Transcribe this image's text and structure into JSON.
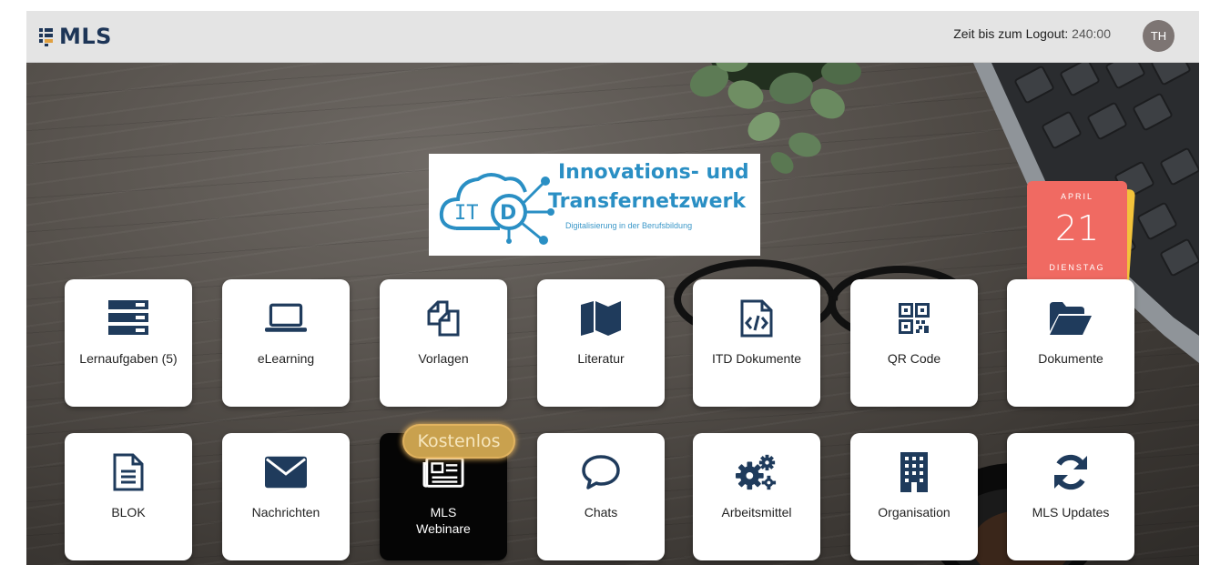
{
  "header": {
    "logo_text": "MLS",
    "logout_label": "Zeit bis zum Logout:",
    "logout_time": "240:00",
    "avatar_initials": "TH"
  },
  "banner": {
    "title_line1": "Innovations- und",
    "title_line2": "Transfernetzwerk",
    "subtitle": "Digitalisierung in der Berufsbildung"
  },
  "calendar": {
    "month": "APRIL",
    "day": "21",
    "weekday": "DIENSTAG"
  },
  "tiles": {
    "lernaufgaben": {
      "label": "Lernaufgaben (5)",
      "icon": "server-stack-icon"
    },
    "elearning": {
      "label": "eLearning",
      "icon": "laptop-icon"
    },
    "vorlagen": {
      "label": "Vorlagen",
      "icon": "copy-files-icon"
    },
    "literatur": {
      "label": "Literatur",
      "icon": "book-open-icon"
    },
    "itd_dokumente": {
      "label": "ITD Dokumente",
      "icon": "code-file-icon"
    },
    "qr_code": {
      "label": "QR Code",
      "icon": "qr-code-icon"
    },
    "dokumente": {
      "label": "Dokumente",
      "icon": "folder-open-icon"
    },
    "blok": {
      "label": "BLOK",
      "icon": "document-icon"
    },
    "nachrichten": {
      "label": "Nachrichten",
      "icon": "envelope-icon"
    },
    "webinare": {
      "label": "MLS Webinare",
      "icon": "newspaper-icon",
      "badge": "Kostenlos"
    },
    "chats": {
      "label": "Chats",
      "icon": "speech-bubble-icon"
    },
    "arbeitsmittel": {
      "label": "Arbeitsmittel",
      "icon": "gears-icon"
    },
    "organisation": {
      "label": "Organisation",
      "icon": "building-icon"
    },
    "updates": {
      "label": "MLS Updates",
      "icon": "sync-icon"
    }
  },
  "colors": {
    "header_bg": "#e4e4e4",
    "icon_navy": "#1f3b5c",
    "banner_blue": "#2a8fc4",
    "calendar_red": "#f06a62",
    "calendar_yellow": "#f3c33b",
    "badge_gold": "#c9a14e"
  }
}
